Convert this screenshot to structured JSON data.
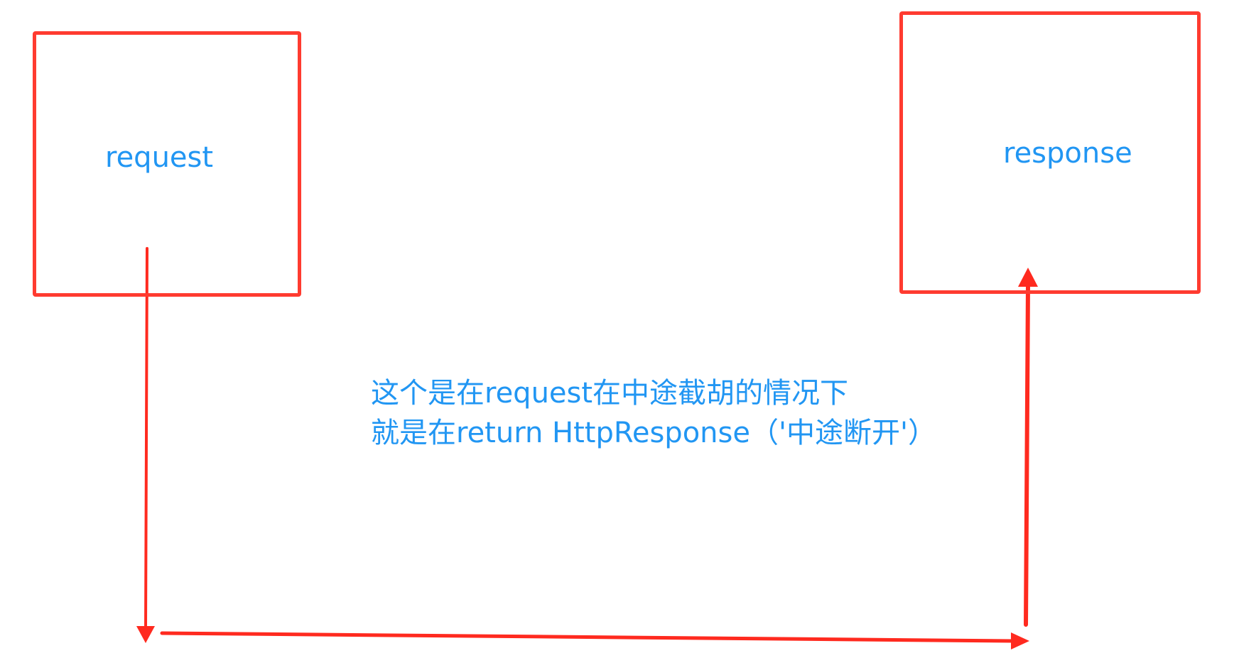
{
  "boxes": {
    "request_label": "request",
    "response_label": "response"
  },
  "annotation": {
    "line1": "这个是在request在中途截胡的情况下",
    "line2": "就是在return HttpResponse（'中途断开'）"
  },
  "colors": {
    "box_border": "#ff3b30",
    "arrow": "#ff2a1f",
    "text": "#2196f3"
  },
  "icons": {
    "arrow_head": "arrow-head-icon"
  }
}
